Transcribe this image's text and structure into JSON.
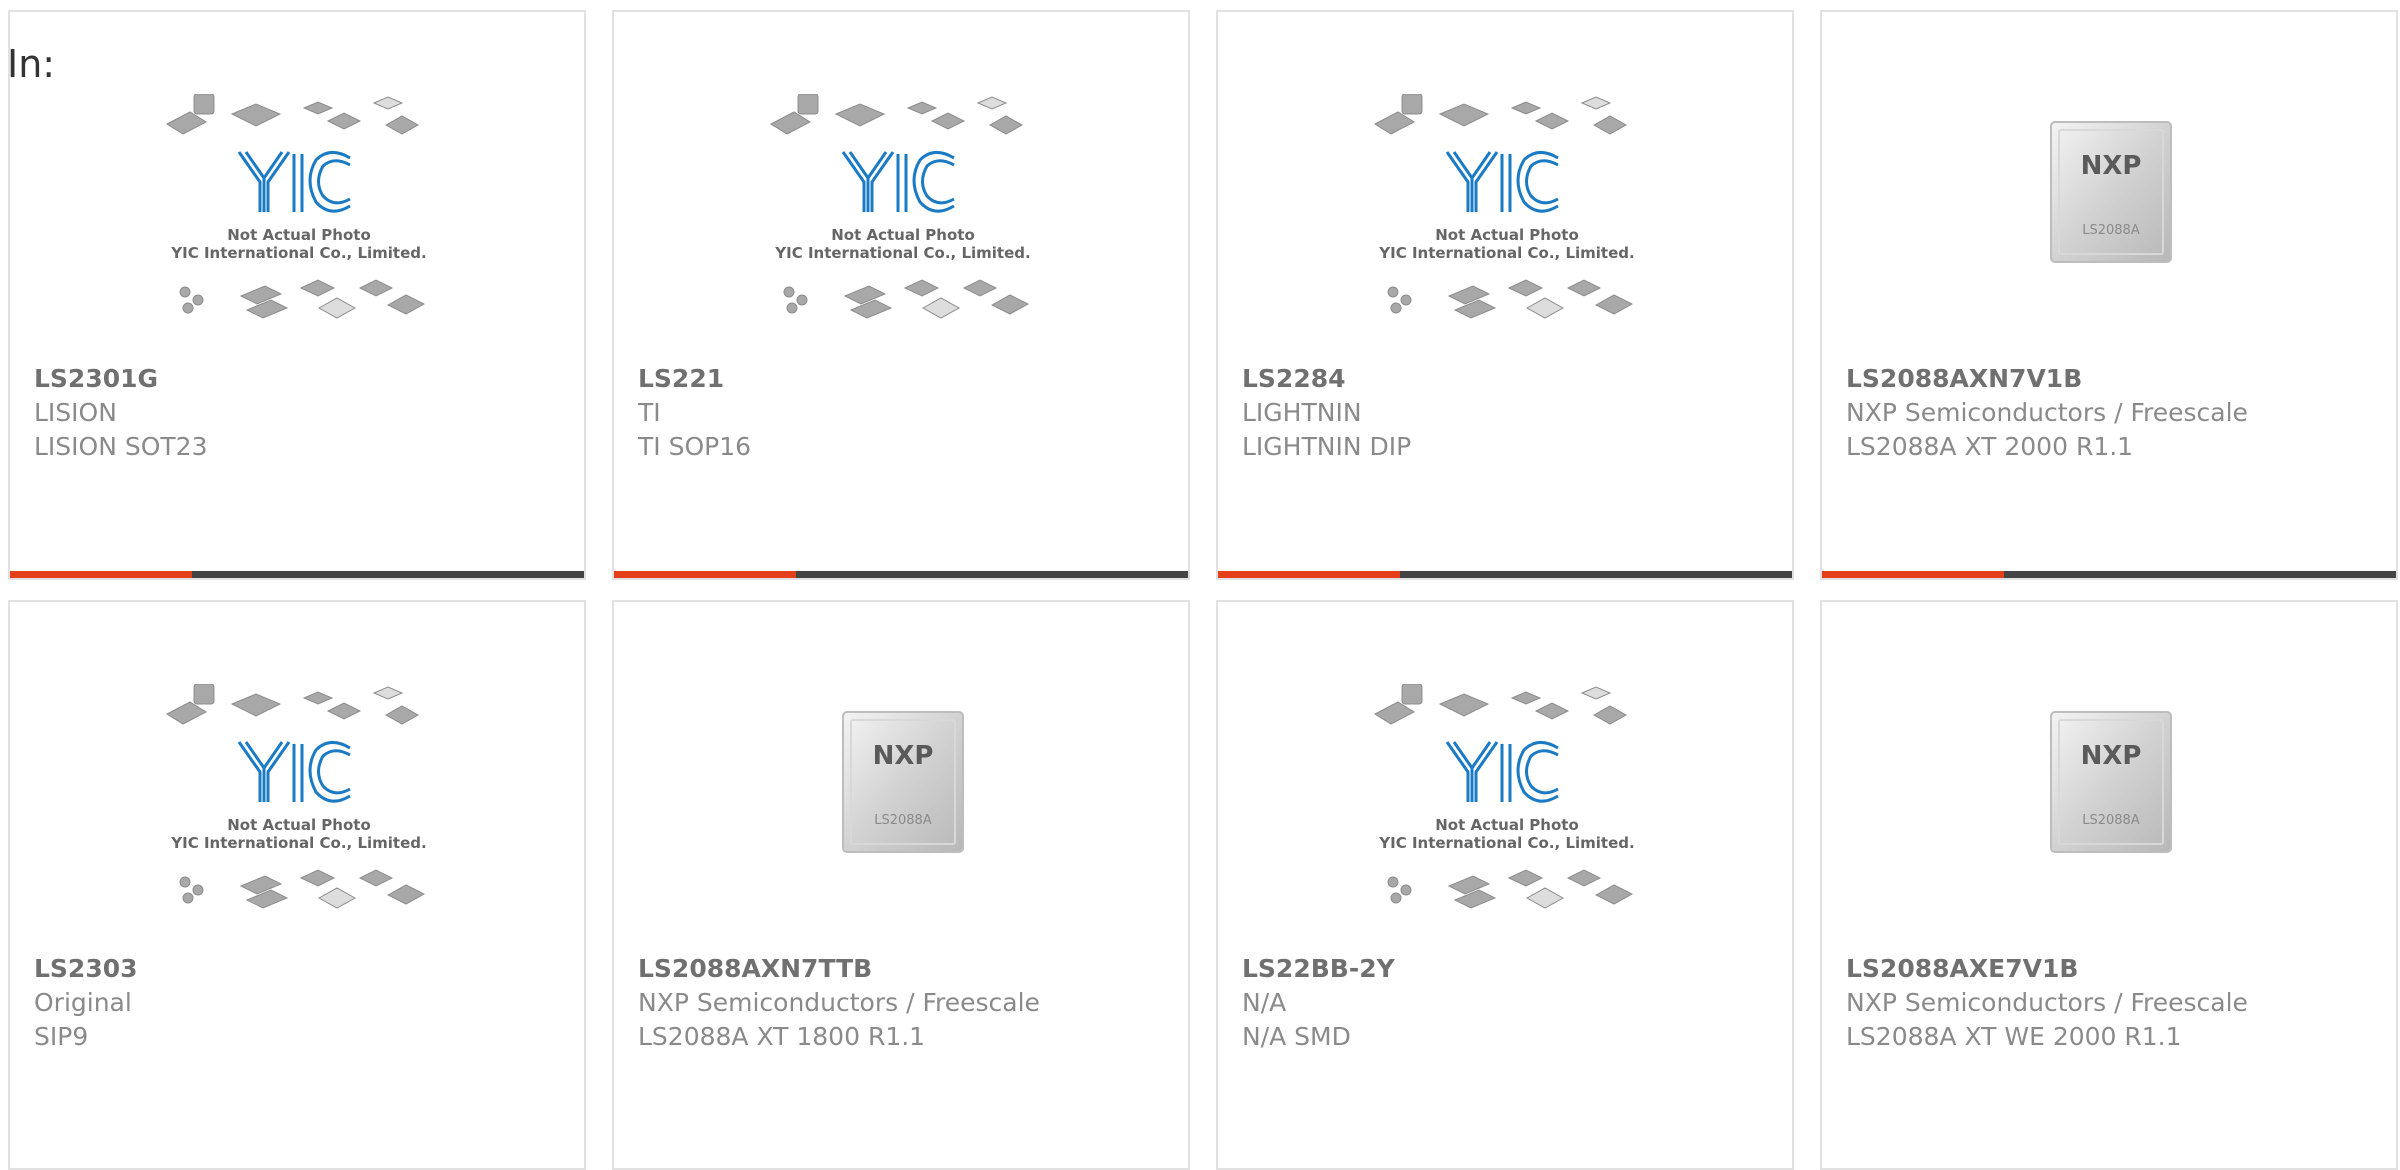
{
  "header": {
    "in_label": "In:"
  },
  "placeholder_photo": {
    "line1": "Not Actual Photo",
    "line2": "YIC International Co., Limited.",
    "logo": "YIC"
  },
  "nxp_chip": {
    "brand": "NXP",
    "marking": "LS2088A"
  },
  "colors": {
    "accent": "#e53f1a",
    "bar": "#444444",
    "yic_blue": "#1a7bc4"
  },
  "products": [
    {
      "part": "LS2301G",
      "maker": "LISION",
      "desc": "LISION SOT23",
      "image": "placeholder"
    },
    {
      "part": "LS221",
      "maker": "TI",
      "desc": "TI SOP16",
      "image": "placeholder"
    },
    {
      "part": "LS2284",
      "maker": "LIGHTNIN",
      "desc": "LIGHTNIN DIP",
      "image": "placeholder"
    },
    {
      "part": "LS2088AXN7V1B",
      "maker": "NXP Semiconductors / Freescale",
      "desc": "LS2088A XT 2000 R1.1",
      "image": "nxp-chip"
    },
    {
      "part": "LS2303",
      "maker": "Original",
      "desc": "SIP9",
      "image": "placeholder"
    },
    {
      "part": "LS2088AXN7TTB",
      "maker": "NXP Semiconductors / Freescale",
      "desc": "LS2088A XT 1800 R1.1",
      "image": "nxp-chip"
    },
    {
      "part": "LS22BB-2Y",
      "maker": "N/A",
      "desc": "N/A SMD",
      "image": "placeholder"
    },
    {
      "part": "LS2088AXE7V1B",
      "maker": "NXP Semiconductors / Freescale",
      "desc": "LS2088A XT WE 2000 R1.1",
      "image": "nxp-chip"
    }
  ]
}
